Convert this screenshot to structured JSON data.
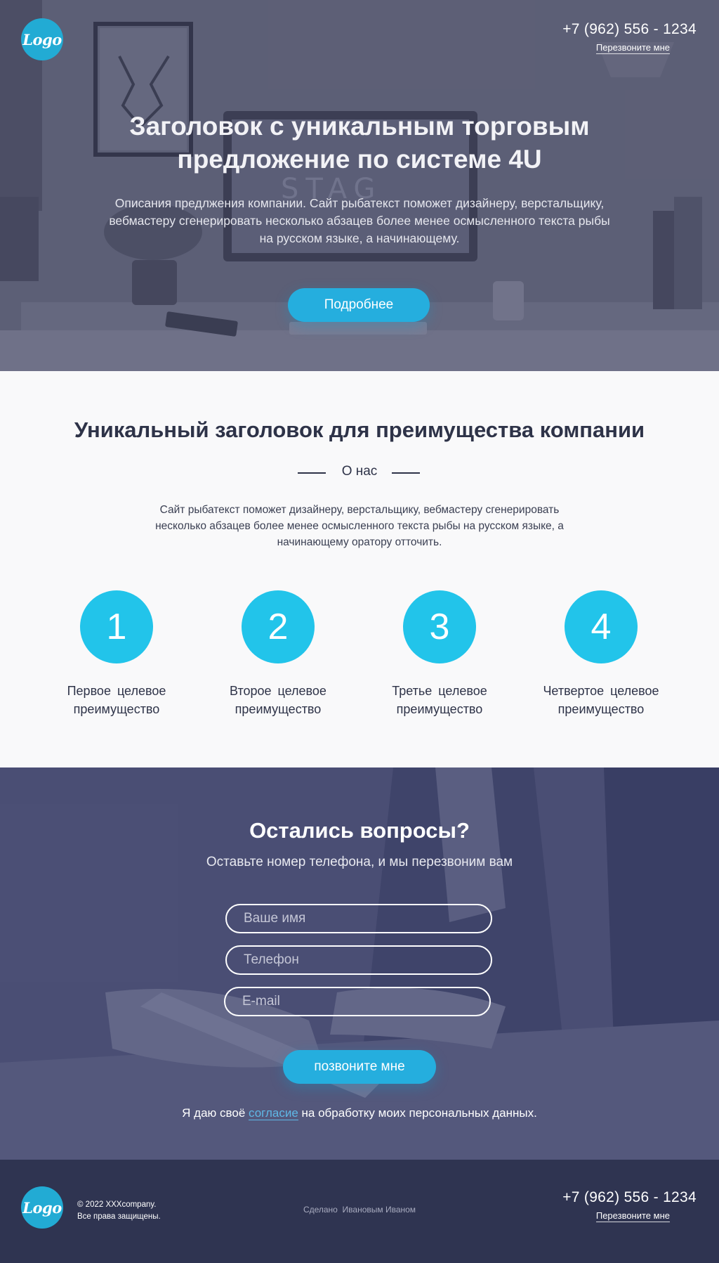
{
  "brand": {
    "logo_text": "Logo",
    "accent": "#22c4ea",
    "dark": "#2e3348"
  },
  "header": {
    "phone": "+7 (962) 556 - 1234",
    "callback_link": "Перезвоните мне"
  },
  "hero": {
    "title_line1": "Заголовок с уникальным торговым",
    "title_line2": "предложение по системе 4U",
    "desc_line1": "Описания предлжения компании. Сайт рыбатекст поможет дизайнеру, верстальщику,",
    "desc_line2": "вебмастеру сгенерировать несколько абзацев более менее осмысленного текста рыбы",
    "desc_line3": "на русском языке, а начинающему.",
    "button": "Подробнее"
  },
  "about": {
    "title": "Уникальный заголовок для преимущества компании",
    "subtitle": "О нас",
    "text_line1": "Сайт рыбатекст поможет дизайнеру, верстальщику, вебмастеру сгенерировать",
    "text_line2": "несколько абзацев более менее осмысленного текста рыбы на русском языке, а",
    "text_line3": "начинающему оратору отточить.",
    "features": [
      {
        "number": "1",
        "line1": "Первое целевое",
        "line2": "преимущество"
      },
      {
        "number": "2",
        "line1": "Второе целевое",
        "line2": "преимущество"
      },
      {
        "number": "3",
        "line1": "Третье целевое",
        "line2": "преимущество"
      },
      {
        "number": "4",
        "line1": "Четвертое целевое",
        "line2": "преимущество"
      }
    ]
  },
  "contact": {
    "title": "Остались вопросы?",
    "subtitle": "Оставьте номер телефона, и мы перезвоним вам",
    "name_placeholder": "Ваше имя",
    "phone_placeholder": "Телефон",
    "email_placeholder": "E-mail",
    "button": "позвоните мне",
    "consent_before": "Я даю своё ",
    "consent_link": "согласие",
    "consent_after": " на обработку моих персональных данных."
  },
  "footer": {
    "copyright_line1": "© 2022 XXXcompany.",
    "copyright_line2": "Все права защищены.",
    "made_by_1": "Сделано",
    "made_by_2": "Ивановым Иваном",
    "phone": "+7 (962) 556 - 1234",
    "callback_link": "Перезвоните мне"
  }
}
